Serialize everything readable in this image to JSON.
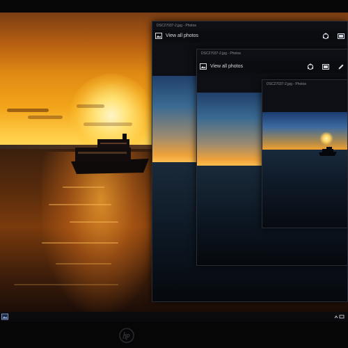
{
  "windows": [
    {
      "title": "DSC27037-2.jpg - Photos",
      "view_all_label": "View all photos"
    },
    {
      "title": "DSC27037-2.jpg - Photos",
      "view_all_label": "View all photos"
    },
    {
      "title": "DSC27037-2.jpg - Photos"
    }
  ],
  "icons": {
    "view_all": "image-gallery-icon",
    "share": "share-icon",
    "slideshow": "slideshow-icon",
    "edit": "pencil-edit-icon",
    "taskbar_start": "photos-app-icon",
    "tray": "system-tray-icons"
  },
  "brand": {
    "logo_text": "hp"
  },
  "colors": {
    "window_bg": "#0d0f14",
    "title_text": "#8a8f9a",
    "sunset": "#f3a51a"
  }
}
